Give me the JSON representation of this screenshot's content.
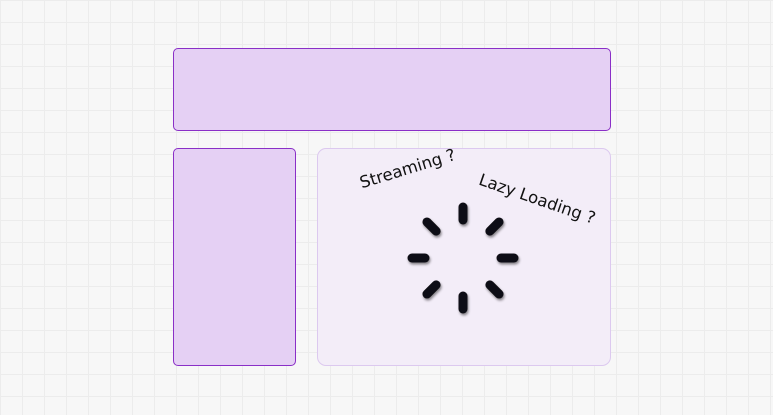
{
  "header": {},
  "sidebar": {},
  "content": {
    "label_streaming": "Streaming ?",
    "label_lazy": "Lazy Loading ?",
    "spinner_icon": "loading-spinner-icon"
  },
  "colors": {
    "panel_fill": "#e5d0f4",
    "panel_border": "#8a2fc7",
    "content_fill": "#f3edf8",
    "content_border": "#dcc9ef",
    "spinner": "#0d0a12"
  }
}
